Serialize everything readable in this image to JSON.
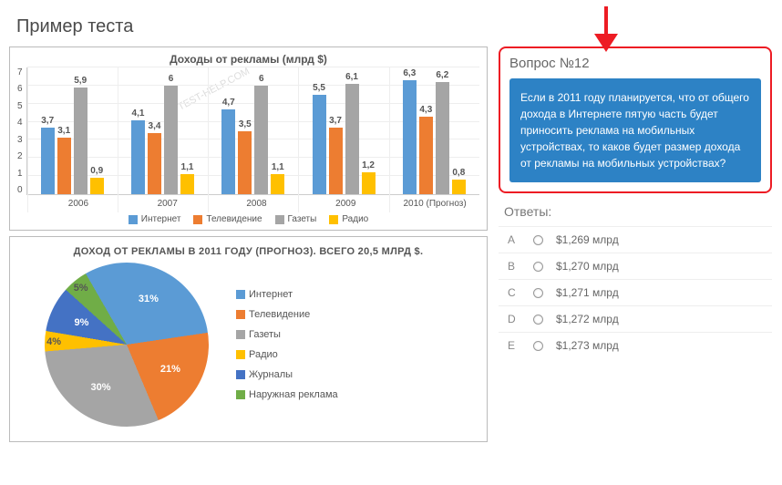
{
  "page_title": "Пример теста",
  "watermark": "TEST-HELP.COM",
  "question": {
    "title": "Вопрос №12",
    "body": "Если в 2011 году планируется, что от общего дохода в Интернете пятую часть будет приносить реклама на мобильных устройствах, то каков будет размер дохода от рекламы на мобильных устройствах?"
  },
  "answers_title": "Ответы:",
  "answers": [
    {
      "letter": "A",
      "text": "$1,269 млрд"
    },
    {
      "letter": "B",
      "text": "$1,270 млрд"
    },
    {
      "letter": "C",
      "text": "$1,271 млрд"
    },
    {
      "letter": "D",
      "text": "$1,272 млрд"
    },
    {
      "letter": "E",
      "text": "$1,273 млрд"
    }
  ],
  "bar_chart": {
    "title": "Доходы от рекламы (млрд $)",
    "ymax": 7,
    "yticks": [
      "7",
      "6",
      "5",
      "4",
      "3",
      "2",
      "1",
      "0"
    ],
    "categories": [
      "2006",
      "2007",
      "2008",
      "2009",
      "2010  (Прогноз)"
    ],
    "series_meta": [
      {
        "name": "Интернет",
        "color": "#5b9bd5"
      },
      {
        "name": "Телевидение",
        "color": "#ed7d31"
      },
      {
        "name": "Газеты",
        "color": "#a5a5a5"
      },
      {
        "name": "Радио",
        "color": "#ffc000"
      }
    ],
    "groups": [
      {
        "values": [
          "3,7",
          "3,1",
          "5,9",
          "0,9"
        ]
      },
      {
        "values": [
          "4,1",
          "3,4",
          "6",
          "1,1"
        ]
      },
      {
        "values": [
          "4,7",
          "3,5",
          "6",
          "1,1"
        ]
      },
      {
        "values": [
          "5,5",
          "3,7",
          "6,1",
          "1,2"
        ]
      },
      {
        "values": [
          "6,3",
          "4,3",
          "6,2",
          "0,8"
        ]
      }
    ]
  },
  "pie_chart": {
    "title": "ДОХОД ОТ РЕКЛАМЫ В 2011 ГОДУ (ПРОГНОЗ). ВСЕГО 20,5 МЛРД $.",
    "slices": [
      {
        "name": "Интернет",
        "value": 31,
        "label": "31%",
        "color": "#5b9bd5"
      },
      {
        "name": "Телевидение",
        "value": 21,
        "label": "21%",
        "color": "#ed7d31"
      },
      {
        "name": "Газеты",
        "value": 30,
        "label": "30%",
        "color": "#a5a5a5"
      },
      {
        "name": "Радио",
        "value": 4,
        "label": "4%",
        "color": "#ffc000"
      },
      {
        "name": "Журналы",
        "value": 9,
        "label": "9%",
        "color": "#4472c4"
      },
      {
        "name": "Наружная реклама",
        "value": 5,
        "label": "5%",
        "color": "#70ad47"
      }
    ]
  },
  "chart_data": [
    {
      "type": "bar",
      "title": "Доходы от рекламы (млрд $)",
      "categories": [
        "2006",
        "2007",
        "2008",
        "2009",
        "2010 (Прогноз)"
      ],
      "series": [
        {
          "name": "Интернет",
          "values": [
            3.7,
            4.1,
            4.7,
            5.5,
            6.3
          ]
        },
        {
          "name": "Телевидение",
          "values": [
            3.1,
            3.4,
            3.5,
            3.7,
            4.3
          ]
        },
        {
          "name": "Газеты",
          "values": [
            5.9,
            6.0,
            6.0,
            6.1,
            6.2
          ]
        },
        {
          "name": "Радио",
          "values": [
            0.9,
            1.1,
            1.1,
            1.2,
            0.8
          ]
        }
      ],
      "ylabel": "млрд $",
      "ylim": [
        0,
        7
      ]
    },
    {
      "type": "pie",
      "title": "Доход от рекламы в 2011 году (прогноз). Всего 20,5 млрд $.",
      "categories": [
        "Интернет",
        "Телевидение",
        "Газеты",
        "Радио",
        "Журналы",
        "Наружная реклама"
      ],
      "values": [
        31,
        21,
        30,
        4,
        9,
        5
      ]
    }
  ]
}
